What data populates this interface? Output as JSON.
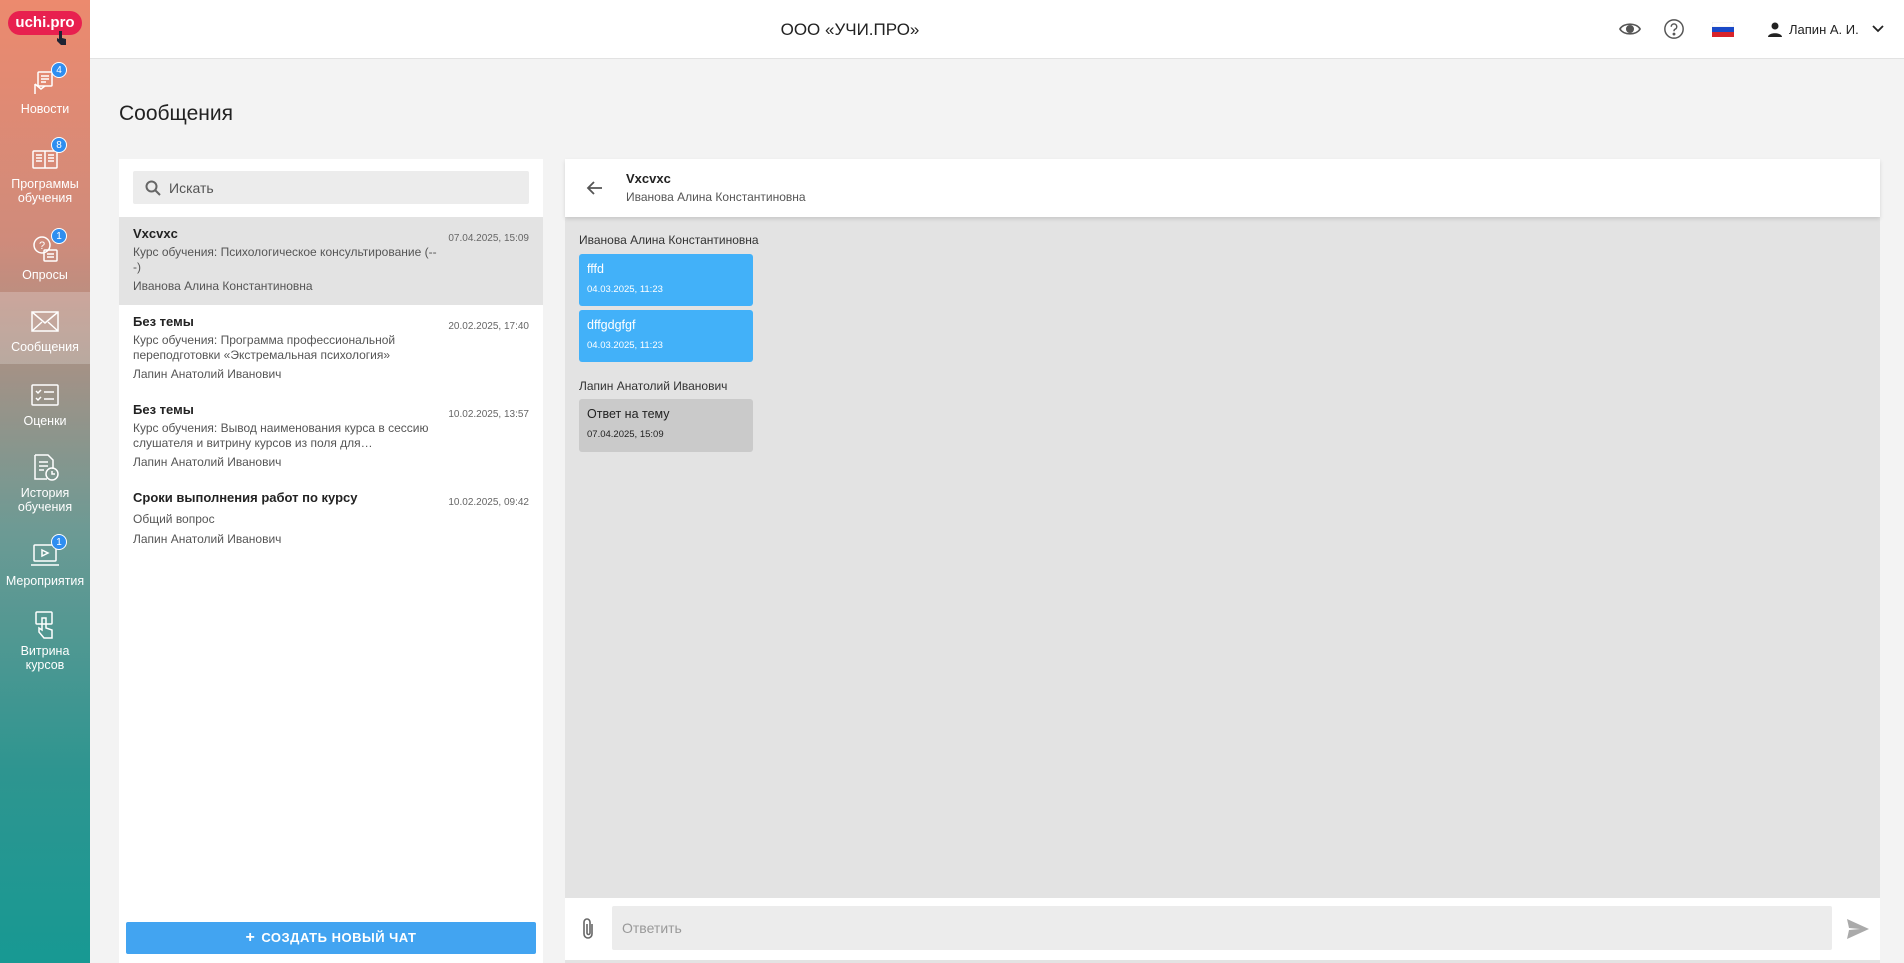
{
  "logo": {
    "text": "uchi.pro"
  },
  "sidebar": {
    "items": [
      {
        "label": "Новости",
        "badge": "4",
        "icon": "hand-newspaper-icon"
      },
      {
        "label": "Программы обучения",
        "badge": "8",
        "icon": "books-icon"
      },
      {
        "label": "Опросы",
        "badge": "1",
        "icon": "survey-icon"
      },
      {
        "label": "Сообщения",
        "badge": "",
        "icon": "envelope-icon",
        "active": true
      },
      {
        "label": "Оценки",
        "badge": "",
        "icon": "grades-icon"
      },
      {
        "label": "История обучения",
        "badge": "",
        "icon": "history-icon"
      },
      {
        "label": "Мероприятия",
        "badge": "1",
        "icon": "events-icon"
      },
      {
        "label": "Витрина курсов",
        "badge": "",
        "icon": "showcase-icon"
      }
    ]
  },
  "header": {
    "org_title": "ООО «УЧИ.ПРО»",
    "user_name": "Лапин А. И."
  },
  "page": {
    "title": "Сообщения"
  },
  "search": {
    "placeholder": "Искать"
  },
  "chats": [
    {
      "title": "Vxcvxc",
      "course": "Курс обучения: Психологическое консультирование (-- -)",
      "author": "Иванова Алина Константиновна",
      "date": "07.04.2025, 15:09",
      "selected": true
    },
    {
      "title": "Без темы",
      "course": "Курс обучения: Программа профессиональной переподготовки «Экстремальная психология»",
      "author": "Лапин Анатолий Иванович",
      "date": "20.02.2025, 17:40"
    },
    {
      "title": "Без темы",
      "course": "Курс обучения: Вывод наименования курса в сессию слушателя и витрину курсов из поля для…",
      "author": "Лапин Анатолий Иванович",
      "date": "10.02.2025, 13:57"
    },
    {
      "title": "Сроки выполнения работ по курсу",
      "course": "Общий вопрос",
      "author": "Лапин Анатолий Иванович",
      "date": "10.02.2025, 09:42"
    }
  ],
  "new_chat_label": "СОЗДАТЬ НОВЫЙ ЧАТ",
  "conversation": {
    "title": "Vxcvxc",
    "subtitle": "Иванова Алина Константиновна",
    "groups": [
      {
        "sender": "Иванова Алина Константиновна",
        "messages": [
          {
            "text": "fffd",
            "time": "04.03.2025, 11:23"
          },
          {
            "text": "dffgdgfgf",
            "time": "04.03.2025, 11:23"
          }
        ]
      },
      {
        "sender": "Лапин Анатолий Иванович",
        "messages": [
          {
            "text": "Ответ на тему",
            "time": "07.04.2025, 15:09"
          }
        ]
      }
    ],
    "reply_placeholder": "Ответить"
  },
  "colors": {
    "accent": "#42a4f1",
    "incoming_bubble": "#42b1f9",
    "outgoing_bubble": "#cacaca",
    "badge": "#2f8ef0",
    "logo": "#e8204f"
  }
}
